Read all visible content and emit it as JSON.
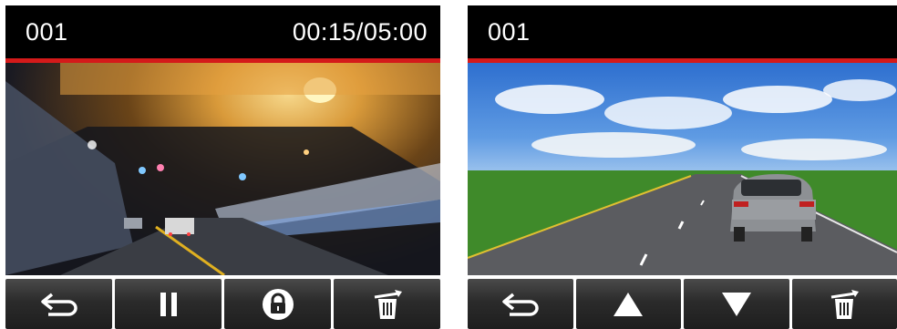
{
  "left_screen": {
    "file_number": "001",
    "time": "00:15/05:00",
    "buttons": [
      {
        "icon": "return-icon"
      },
      {
        "icon": "pause-icon"
      },
      {
        "icon": "lock-icon"
      },
      {
        "icon": "delete-icon"
      }
    ]
  },
  "right_screen": {
    "file_number": "001",
    "buttons": [
      {
        "icon": "return-icon"
      },
      {
        "icon": "up-arrow-icon"
      },
      {
        "icon": "down-arrow-icon"
      },
      {
        "icon": "delete-icon"
      }
    ]
  },
  "colors": {
    "accent_line": "#d41a1a",
    "bar_background": "#000000",
    "button_face": "#2b2b2b",
    "icon": "#ffffff"
  }
}
